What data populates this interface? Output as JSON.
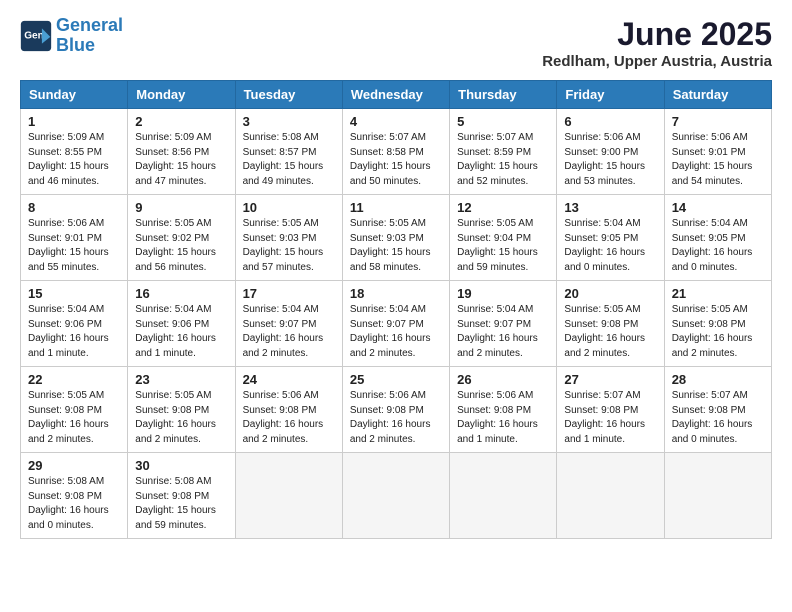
{
  "logo": {
    "line1": "General",
    "line2": "Blue"
  },
  "title": "June 2025",
  "subtitle": "Redlham, Upper Austria, Austria",
  "days_of_week": [
    "Sunday",
    "Monday",
    "Tuesday",
    "Wednesday",
    "Thursday",
    "Friday",
    "Saturday"
  ],
  "weeks": [
    [
      {
        "num": "1",
        "sunrise": "5:09 AM",
        "sunset": "8:55 PM",
        "daylight": "15 hours and 46 minutes."
      },
      {
        "num": "2",
        "sunrise": "5:09 AM",
        "sunset": "8:56 PM",
        "daylight": "15 hours and 47 minutes."
      },
      {
        "num": "3",
        "sunrise": "5:08 AM",
        "sunset": "8:57 PM",
        "daylight": "15 hours and 49 minutes."
      },
      {
        "num": "4",
        "sunrise": "5:07 AM",
        "sunset": "8:58 PM",
        "daylight": "15 hours and 50 minutes."
      },
      {
        "num": "5",
        "sunrise": "5:07 AM",
        "sunset": "8:59 PM",
        "daylight": "15 hours and 52 minutes."
      },
      {
        "num": "6",
        "sunrise": "5:06 AM",
        "sunset": "9:00 PM",
        "daylight": "15 hours and 53 minutes."
      },
      {
        "num": "7",
        "sunrise": "5:06 AM",
        "sunset": "9:01 PM",
        "daylight": "15 hours and 54 minutes."
      }
    ],
    [
      {
        "num": "8",
        "sunrise": "5:06 AM",
        "sunset": "9:01 PM",
        "daylight": "15 hours and 55 minutes."
      },
      {
        "num": "9",
        "sunrise": "5:05 AM",
        "sunset": "9:02 PM",
        "daylight": "15 hours and 56 minutes."
      },
      {
        "num": "10",
        "sunrise": "5:05 AM",
        "sunset": "9:03 PM",
        "daylight": "15 hours and 57 minutes."
      },
      {
        "num": "11",
        "sunrise": "5:05 AM",
        "sunset": "9:03 PM",
        "daylight": "15 hours and 58 minutes."
      },
      {
        "num": "12",
        "sunrise": "5:05 AM",
        "sunset": "9:04 PM",
        "daylight": "15 hours and 59 minutes."
      },
      {
        "num": "13",
        "sunrise": "5:04 AM",
        "sunset": "9:05 PM",
        "daylight": "16 hours and 0 minutes."
      },
      {
        "num": "14",
        "sunrise": "5:04 AM",
        "sunset": "9:05 PM",
        "daylight": "16 hours and 0 minutes."
      }
    ],
    [
      {
        "num": "15",
        "sunrise": "5:04 AM",
        "sunset": "9:06 PM",
        "daylight": "16 hours and 1 minute."
      },
      {
        "num": "16",
        "sunrise": "5:04 AM",
        "sunset": "9:06 PM",
        "daylight": "16 hours and 1 minute."
      },
      {
        "num": "17",
        "sunrise": "5:04 AM",
        "sunset": "9:07 PM",
        "daylight": "16 hours and 2 minutes."
      },
      {
        "num": "18",
        "sunrise": "5:04 AM",
        "sunset": "9:07 PM",
        "daylight": "16 hours and 2 minutes."
      },
      {
        "num": "19",
        "sunrise": "5:04 AM",
        "sunset": "9:07 PM",
        "daylight": "16 hours and 2 minutes."
      },
      {
        "num": "20",
        "sunrise": "5:05 AM",
        "sunset": "9:08 PM",
        "daylight": "16 hours and 2 minutes."
      },
      {
        "num": "21",
        "sunrise": "5:05 AM",
        "sunset": "9:08 PM",
        "daylight": "16 hours and 2 minutes."
      }
    ],
    [
      {
        "num": "22",
        "sunrise": "5:05 AM",
        "sunset": "9:08 PM",
        "daylight": "16 hours and 2 minutes."
      },
      {
        "num": "23",
        "sunrise": "5:05 AM",
        "sunset": "9:08 PM",
        "daylight": "16 hours and 2 minutes."
      },
      {
        "num": "24",
        "sunrise": "5:06 AM",
        "sunset": "9:08 PM",
        "daylight": "16 hours and 2 minutes."
      },
      {
        "num": "25",
        "sunrise": "5:06 AM",
        "sunset": "9:08 PM",
        "daylight": "16 hours and 2 minutes."
      },
      {
        "num": "26",
        "sunrise": "5:06 AM",
        "sunset": "9:08 PM",
        "daylight": "16 hours and 1 minute."
      },
      {
        "num": "27",
        "sunrise": "5:07 AM",
        "sunset": "9:08 PM",
        "daylight": "16 hours and 1 minute."
      },
      {
        "num": "28",
        "sunrise": "5:07 AM",
        "sunset": "9:08 PM",
        "daylight": "16 hours and 0 minutes."
      }
    ],
    [
      {
        "num": "29",
        "sunrise": "5:08 AM",
        "sunset": "9:08 PM",
        "daylight": "16 hours and 0 minutes."
      },
      {
        "num": "30",
        "sunrise": "5:08 AM",
        "sunset": "9:08 PM",
        "daylight": "15 hours and 59 minutes."
      },
      null,
      null,
      null,
      null,
      null
    ]
  ]
}
